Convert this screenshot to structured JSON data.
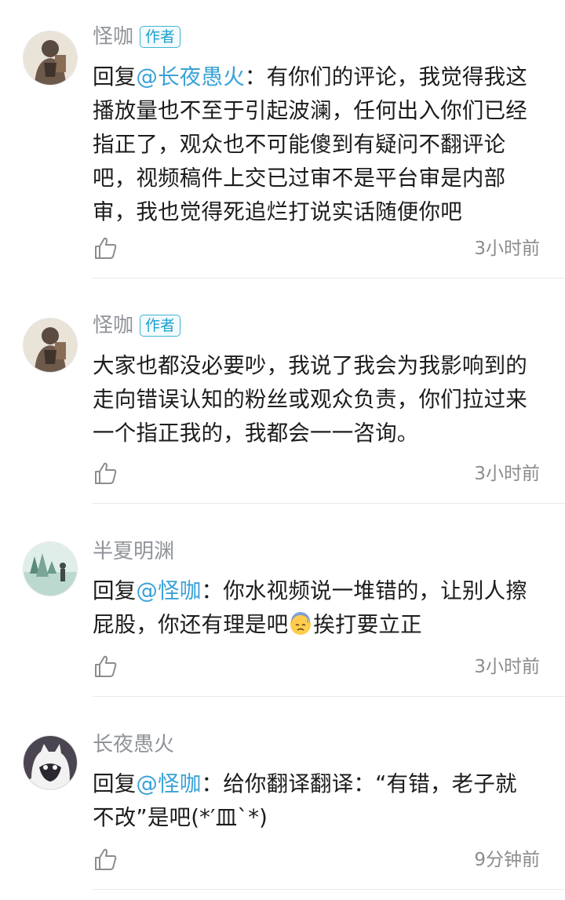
{
  "comments": [
    {
      "username": "怪咖",
      "badge": "作者",
      "reply_prefix": "回复",
      "mention": "@长夜愚火",
      "text": "：有你们的评论，我觉得我这播放量也不至于引起波澜，任何出入你们已经指正了，观众也不可能傻到有疑问不翻评论吧，视频稿件上交已过审不是平台审是内部审，我也觉得死追烂打说实话随便你吧",
      "time": "3小时前"
    },
    {
      "username": "怪咖",
      "badge": "作者",
      "text": "大家也都没必要吵，我说了我会为我影响到的走向错误认知的粉丝或观众负责，你们拉过来一个指正我的，我都会一一咨询。",
      "time": "3小时前"
    },
    {
      "username": "半夏明渊",
      "reply_prefix": "回复",
      "mention": "@怪咖",
      "text_before_emoji": "：你水视频说一堆错的，让别人擦屁股，你还有理是吧",
      "emoji": "sweat-face-emoji",
      "text_after_emoji": "挨打要立正",
      "time": "3小时前"
    },
    {
      "username": "长夜愚火",
      "reply_prefix": "回复",
      "mention": "@怪咖",
      "text": "：给你翻译翻译：“有错，老子就不改”是吧(*′皿`*)",
      "time": "9分钟前"
    }
  ],
  "icons": {
    "like": "thumbs-up-icon"
  },
  "colors": {
    "mention": "#3aa2d6",
    "badge": "#1da1cc",
    "username": "#909399",
    "time": "#8c8c8c"
  }
}
